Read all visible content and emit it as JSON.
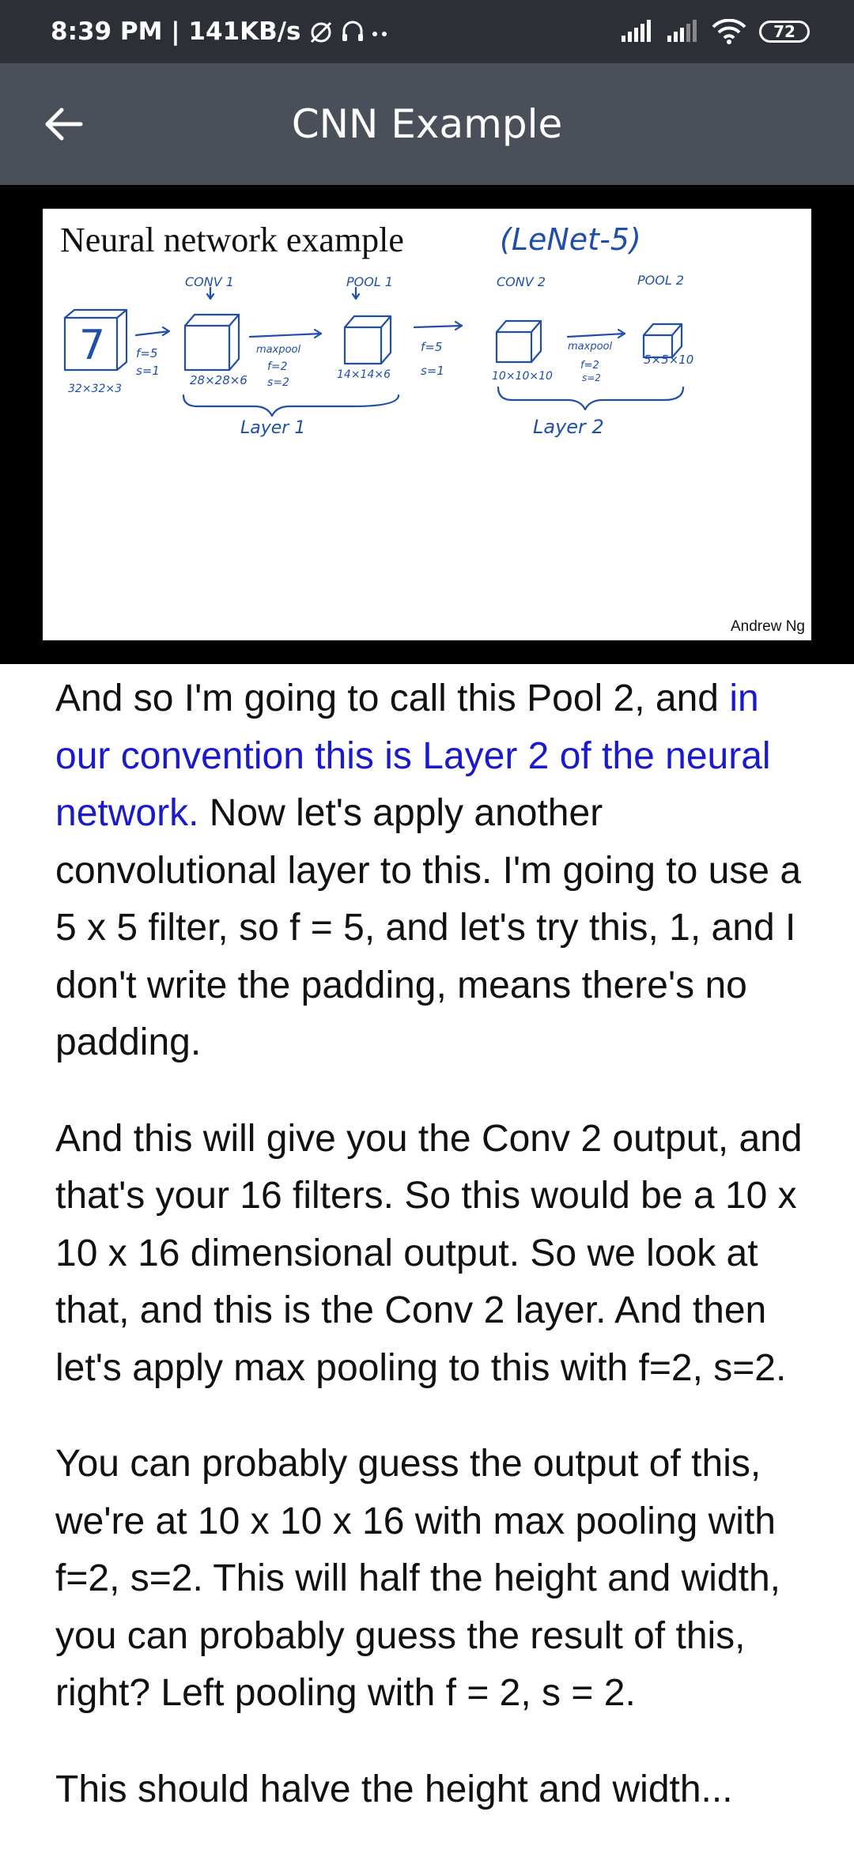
{
  "status_bar": {
    "time_speed": "8:39 PM | 141KB/s",
    "battery": "72"
  },
  "app_bar": {
    "title": "CNN Example"
  },
  "slide": {
    "title": "Neural network example",
    "subtitle": "(LeNet-5)",
    "author": "Andrew Ng",
    "annotations": {
      "conv1": "CONV 1",
      "pool1": "POOL 1",
      "conv2": "CONV 2",
      "pool2": "POOL 2",
      "input_digit": "7",
      "input_dims": "32×32×3",
      "f5_s1_a": "f=5",
      "s1_a": "s=1",
      "dims_28": "28×28×6",
      "maxpool_a": "maxpool",
      "f2_a": "f=2",
      "s2_a": "s=2",
      "dims_14": "14×14×6",
      "f5_b": "f=5",
      "s1_b": "s=1",
      "dims_10": "10×10×10",
      "maxpool_b": "maxpool",
      "f2_b": "f=2",
      "s2_b": "s=2",
      "dims_5": "5×5×10",
      "layer1": "Layer 1",
      "layer2": "Layer 2"
    }
  },
  "transcript": {
    "p1_before": "And so I'm going to call this Pool 2, and ",
    "p1_highlight": "in our convention this is Layer 2 of the neural network.",
    "p1_after": " Now let's apply another convolutional layer to this. I'm going to use a 5 x 5 filter, so f = 5, and let's try this, 1, and I don't write the padding, means there's no padding.",
    "p2": "And this will give you the Conv 2 output, and that's your 16 filters. So this would be a 10 x 10 x 16 dimensional output. So we look at that, and this is the Conv 2 layer. And then let's apply max pooling to this with f=2, s=2.",
    "p3": "You can probably guess the output of this, we're at 10 x 10 x 16 with max pooling with f=2, s=2. This will half the height and width, you can probably guess the result of this, right? Left pooling with f = 2, s = 2.",
    "p4": "This should halve the height and width..."
  },
  "colors": {
    "status_bg": "#2c3036",
    "app_bar_bg": "#4a5059",
    "highlight": "#1a1acc",
    "ink": "#1f4fa8"
  }
}
